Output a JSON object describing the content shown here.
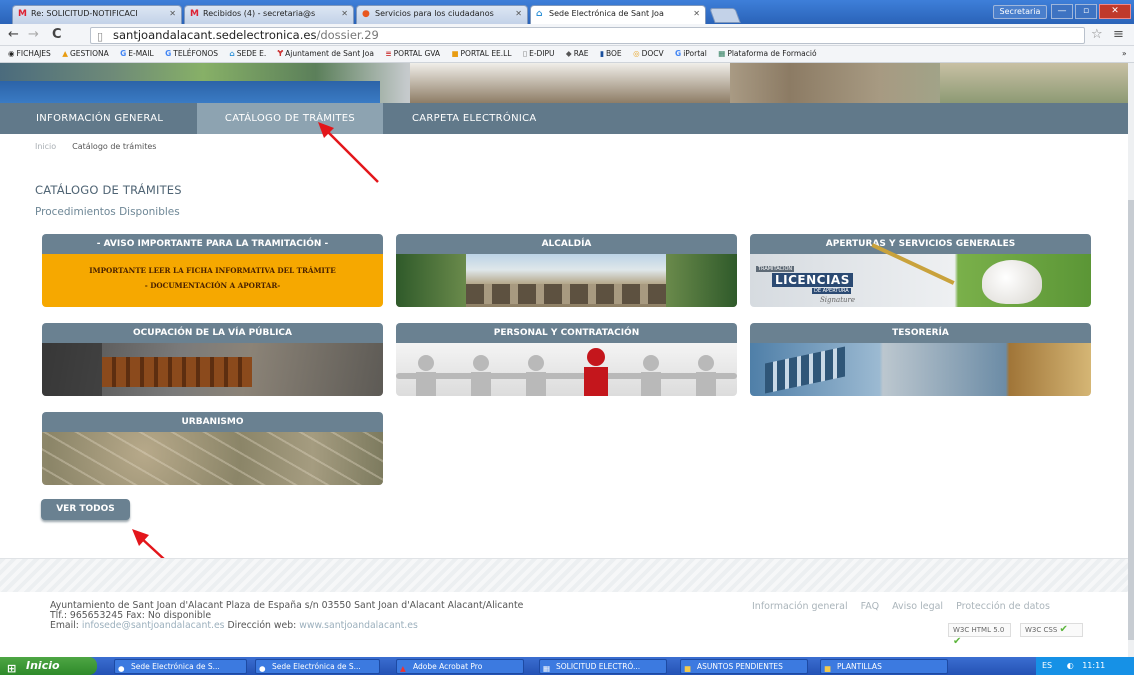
{
  "browser": {
    "tabs": [
      {
        "label": "Re: SOLICITUD-NOTIFICACI",
        "icon": "gmail-icon"
      },
      {
        "label": "Recibidos (4) - secretaria@s",
        "icon": "gmail-icon"
      },
      {
        "label": "Servicios para los ciudadanos",
        "icon": "hands-icon"
      },
      {
        "label": "Sede Electrónica de Sant Joa",
        "icon": "sede-icon"
      }
    ],
    "profile": "Secretaria",
    "url_domain": "santjoandalacant.sedelectronica.es",
    "url_path": "/dossier.29",
    "bookmarks": [
      "FICHAJES",
      "GESTIONA",
      "E-MAIL",
      "TELÉFONOS",
      "SEDE E.",
      "Ajuntament de Sant Joa",
      "PORTAL GVA",
      "PORTAL EE.LL",
      "E-DIPU",
      "RAE",
      "BOE",
      "DOCV",
      "iPortal",
      "Plataforma de Formació"
    ],
    "more": "»"
  },
  "nav": {
    "items": [
      "INFORMACIÓN GENERAL",
      "CATÁLOGO DE TRÁMITES",
      "CARPETA ELECTRÓNICA"
    ],
    "active": "CATÁLOGO DE TRÁMITES"
  },
  "breadcrumb": {
    "home": "Inicio",
    "current": "Catálogo de trámites"
  },
  "page": {
    "title": "CATÁLOGO DE TRÁMITES",
    "subtitle": "Procedimientos Disponibles",
    "cards": [
      {
        "title": "- AVISO IMPORTANTE PARA LA TRAMITACIÓN -",
        "line1": "IMPORTANTE LEER LA FICHA INFORMATIVA DEL TRÁMITE",
        "line2": "- DOCUMENTACIÓN A APORTAR-"
      },
      {
        "title": "ALCALDÍA"
      },
      {
        "title": "APERTURAS Y SERVICIOS GENERALES",
        "img_text": "LICENCIAS",
        "img_sub": "DE APERTURA",
        "img_tag": "TRAMITACIÓN",
        "img_sig": "Signature"
      },
      {
        "title": "OCUPACIÓN DE LA VÍA PÚBLICA"
      },
      {
        "title": "PERSONAL Y CONTRATACIÓN"
      },
      {
        "title": "TESORERÍA"
      },
      {
        "title": "URBANISMO"
      }
    ],
    "ver_todos": "VER TODOS"
  },
  "footer": {
    "address": "Ayuntamiento de Sant Joan d'Alacant Plaza de España s/n 03550 Sant Joan d'Alacant Alacant/Alicante",
    "phone": "Tlf.: 965653245 Fax: No disponible",
    "email_label": "Email:",
    "email": "infosede@santjoandalacant.es",
    "web_label": "Dirección web:",
    "web": "www.santjoandalacant.es",
    "links": [
      "Información general",
      "FAQ",
      "Aviso legal",
      "Protección de datos"
    ],
    "badge_html": "W3C HTML 5.0",
    "badge_css": "W3C CSS"
  },
  "taskbar": {
    "start": "Inicio",
    "items": [
      "Sede Electrónica de S...",
      "Sede Electrónica de S...",
      "Adobe Acrobat Pro",
      "SOLICITUD ELECTRÓ...",
      "ASUNTOS PENDIENTES",
      "PLANTILLAS"
    ],
    "lang": "ES",
    "clock": "11:11"
  }
}
